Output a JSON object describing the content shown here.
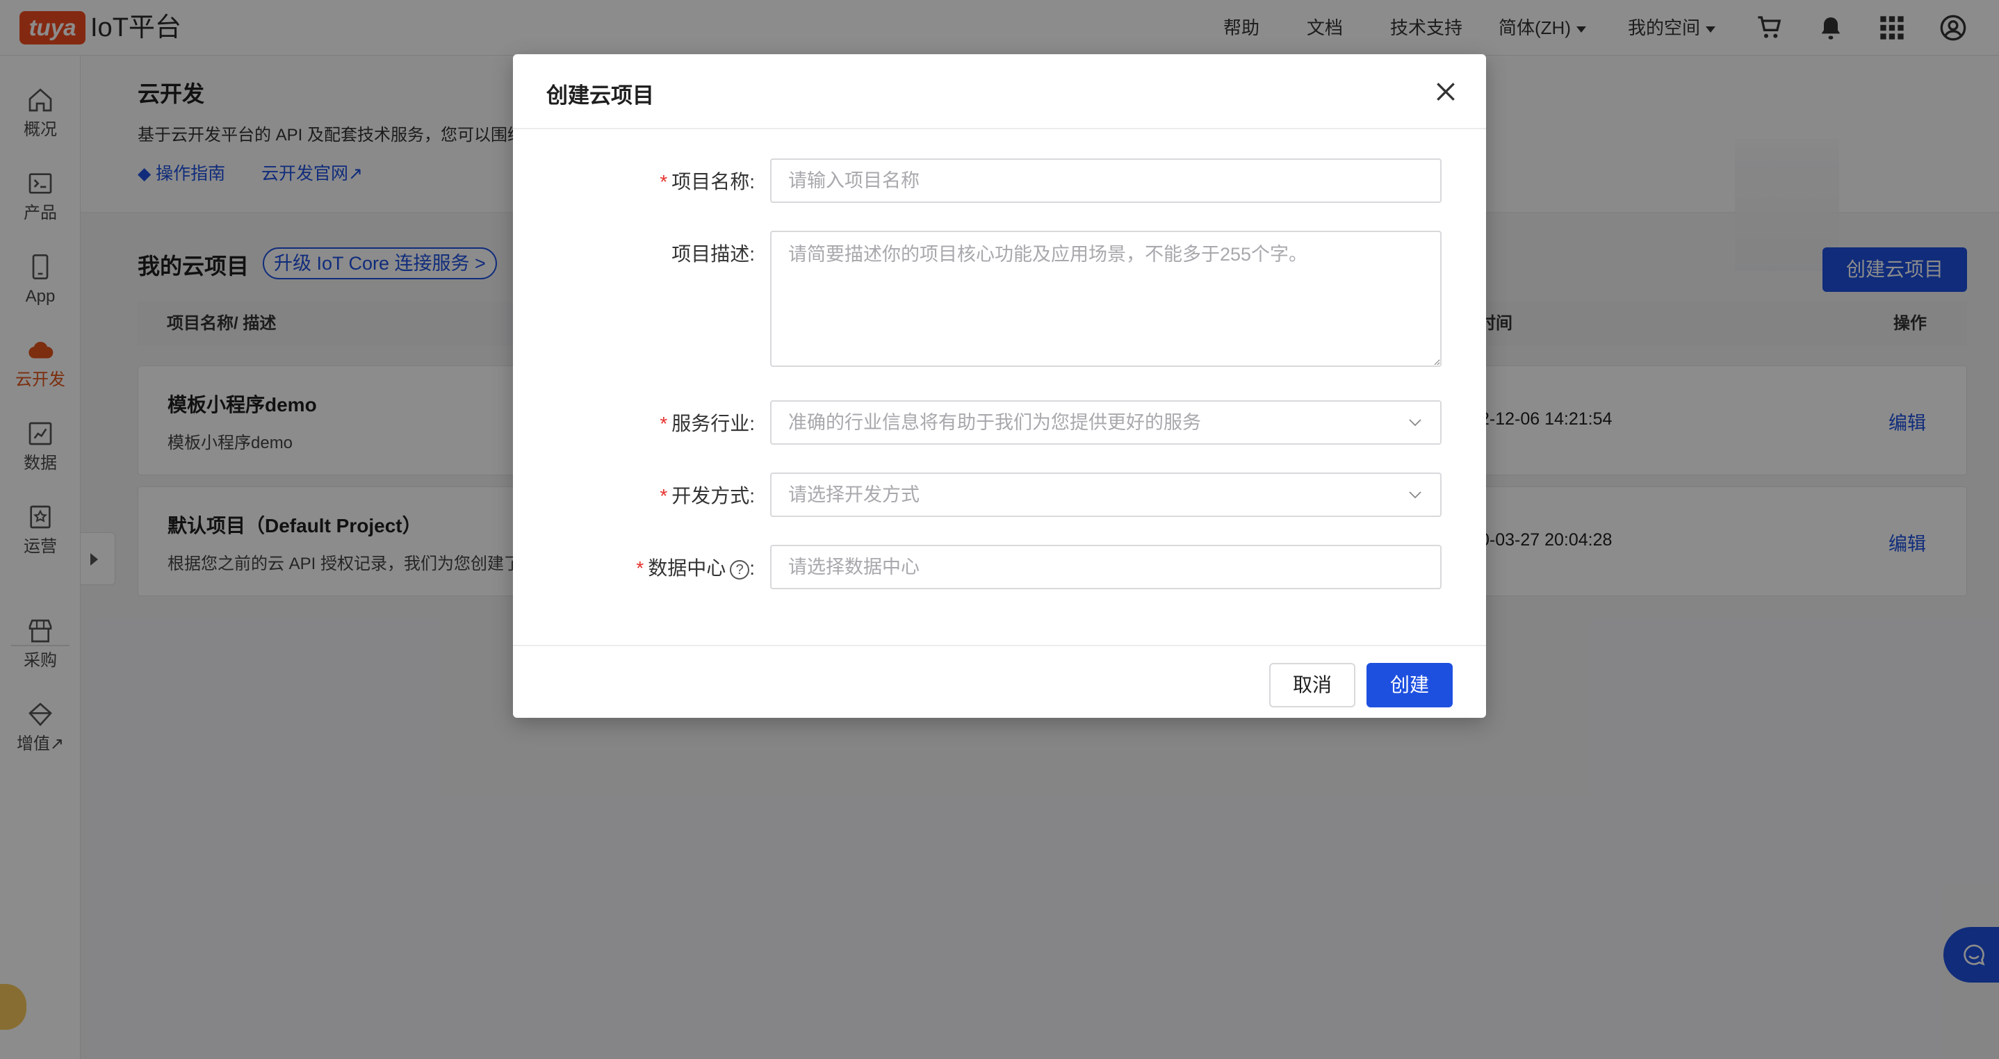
{
  "app": {
    "logo_mark": "tuya",
    "logo_text": "IoT平台"
  },
  "topnav": {
    "help": "帮助",
    "docs": "文档",
    "support": "技术支持",
    "language": "简体(ZH)",
    "workspace": "我的空间",
    "icons": [
      "cart-icon",
      "bell-icon",
      "apps-grid-icon",
      "user-icon"
    ]
  },
  "sidebar": {
    "items": [
      {
        "label": "概况",
        "icon": "home-icon"
      },
      {
        "label": "产品",
        "icon": "terminal-icon"
      },
      {
        "label": "App",
        "icon": "phone-icon"
      },
      {
        "label": "云开发",
        "icon": "cloud-icon",
        "active": true
      },
      {
        "label": "数据",
        "icon": "chart-icon"
      },
      {
        "label": "运营",
        "icon": "badge-icon"
      },
      {
        "label": "采购",
        "icon": "store-icon"
      },
      {
        "label": "增值↗",
        "icon": "diamond-icon"
      }
    ],
    "accent_color": "#e2541b"
  },
  "hero": {
    "title": "云开发",
    "description": "基于云开发平台的 API 及配套技术服务，您可以围绕",
    "guide_link": "操作指南",
    "site_link": "云开发官网↗"
  },
  "projects": {
    "section_title": "我的云项目",
    "upgrade_label": "升级 IoT Core 连接服务 >",
    "create_button": "创建云项目",
    "columns": [
      "项目名称/ 描述",
      "时间",
      "操作"
    ],
    "rows": [
      {
        "name": "模板小程序demo",
        "desc": "模板小程序demo",
        "time": "2-12-06 14:21:54",
        "action": "编辑"
      },
      {
        "name": "默认项目（Default Project）",
        "desc": "根据您之前的云 API 授权记录，我们为您创建了",
        "time": "0-03-27 20:04:28",
        "action": "编辑"
      }
    ]
  },
  "modal": {
    "title": "创建云项目",
    "fields": {
      "name": {
        "label": "项目名称:",
        "placeholder": "请输入项目名称",
        "required": true
      },
      "description": {
        "label": "项目描述:",
        "placeholder": "请简要描述你的项目核心功能及应用场景，不能多于255个字。",
        "required": false
      },
      "industry": {
        "label": "服务行业:",
        "placeholder": "准确的行业信息将有助于我们为您提供更好的服务",
        "required": true
      },
      "dev_mode": {
        "label": "开发方式:",
        "placeholder": "请选择开发方式",
        "required": true
      },
      "data_center": {
        "label": "数据中心",
        "placeholder": "请选择数据中心",
        "required": true
      }
    },
    "required_mark": "*",
    "help_mark": "?",
    "colon": ":",
    "cancel_label": "取消",
    "create_label": "创建"
  },
  "colors": {
    "primary": "#1e50e0",
    "brand": "#f04c1f",
    "required": "#e5322d"
  }
}
